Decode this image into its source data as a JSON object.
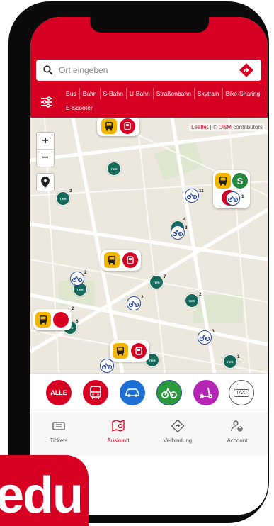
{
  "search": {
    "placeholder": "Ort eingeben"
  },
  "filters": [
    "Bus",
    "Bahn",
    "S-Bahn",
    "U-Bahn",
    "Straßenbahn",
    "Skytrain",
    "Bike-Sharing",
    "E-Scooter"
  ],
  "map": {
    "attribution_leaflet": "Leaflet",
    "attribution_sep": " | © ",
    "attribution_osm": "OSM",
    "attribution_rest": " contributors",
    "zoom_in": "+",
    "zoom_out": "−",
    "pin_label": "TIER",
    "s_bahn_label": "S",
    "counts": [
      "3",
      "11",
      "4",
      "3",
      "2",
      "7",
      "3",
      "2",
      "3",
      "6",
      "2",
      "3",
      "1"
    ]
  },
  "modes": {
    "alle": "ALLE",
    "taxi": "TAXI"
  },
  "tabs": [
    {
      "label": "Tickets"
    },
    {
      "label": "Auskunft"
    },
    {
      "label": "Verbindung"
    },
    {
      "label": "Account"
    }
  ],
  "brand": {
    "text": "edu"
  },
  "colors": {
    "primary": "#d80022",
    "tier": "#16695a",
    "bus_yellow": "#f2b600",
    "car_blue": "#1d6fd3",
    "bike_green": "#2a9a3c",
    "scooter_purple": "#b626b5"
  }
}
